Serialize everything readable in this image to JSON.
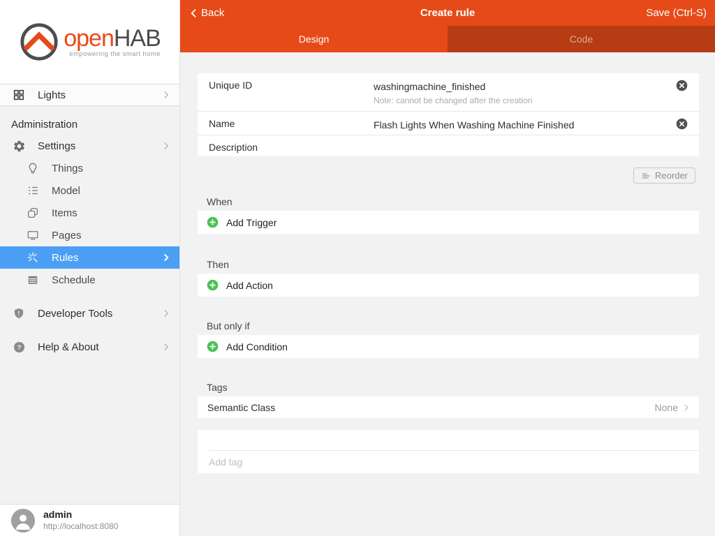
{
  "colors": {
    "brand_orange": "#e64a19",
    "tab_inactive_orange": "#b53c13",
    "selected_blue": "#4a9ff5",
    "add_green": "#4bc154",
    "content_bg": "#f2f2f2"
  },
  "topbar": {
    "back_label": "Back",
    "title": "Create rule",
    "save_label": "Save (Ctrl-S)"
  },
  "tabs": {
    "design": "Design",
    "code": "Code"
  },
  "sidebar": {
    "logo": {
      "brand_open": "open",
      "brand_hab": "HAB",
      "tagline": "empowering the smart home"
    },
    "lights_label": "Lights",
    "admin_section_label": "Administration",
    "items": [
      {
        "label": "Settings"
      },
      {
        "label": "Things"
      },
      {
        "label": "Model"
      },
      {
        "label": "Items"
      },
      {
        "label": "Pages"
      },
      {
        "label": "Rules"
      },
      {
        "label": "Schedule"
      },
      {
        "label": "Developer Tools"
      },
      {
        "label": "Help & About"
      }
    ],
    "user": {
      "name": "admin",
      "url": "http://localhost:8080"
    }
  },
  "form": {
    "unique_id": {
      "label": "Unique ID",
      "value": "washingmachine_finished",
      "note": "Note: cannot be changed after the creation"
    },
    "name": {
      "label": "Name",
      "value": "Flash Lights When Washing Machine Finished"
    },
    "description": {
      "label": "Description",
      "value": ""
    },
    "reorder_label": "Reorder"
  },
  "sections": {
    "when": {
      "label": "When",
      "add_label": "Add Trigger"
    },
    "then": {
      "label": "Then",
      "add_label": "Add Action"
    },
    "but_only_if": {
      "label": "But only if",
      "add_label": "Add Condition"
    },
    "tags": {
      "label": "Tags",
      "semantic_class_label": "Semantic Class",
      "semantic_class_value": "None",
      "add_tag_placeholder": "Add tag"
    }
  }
}
